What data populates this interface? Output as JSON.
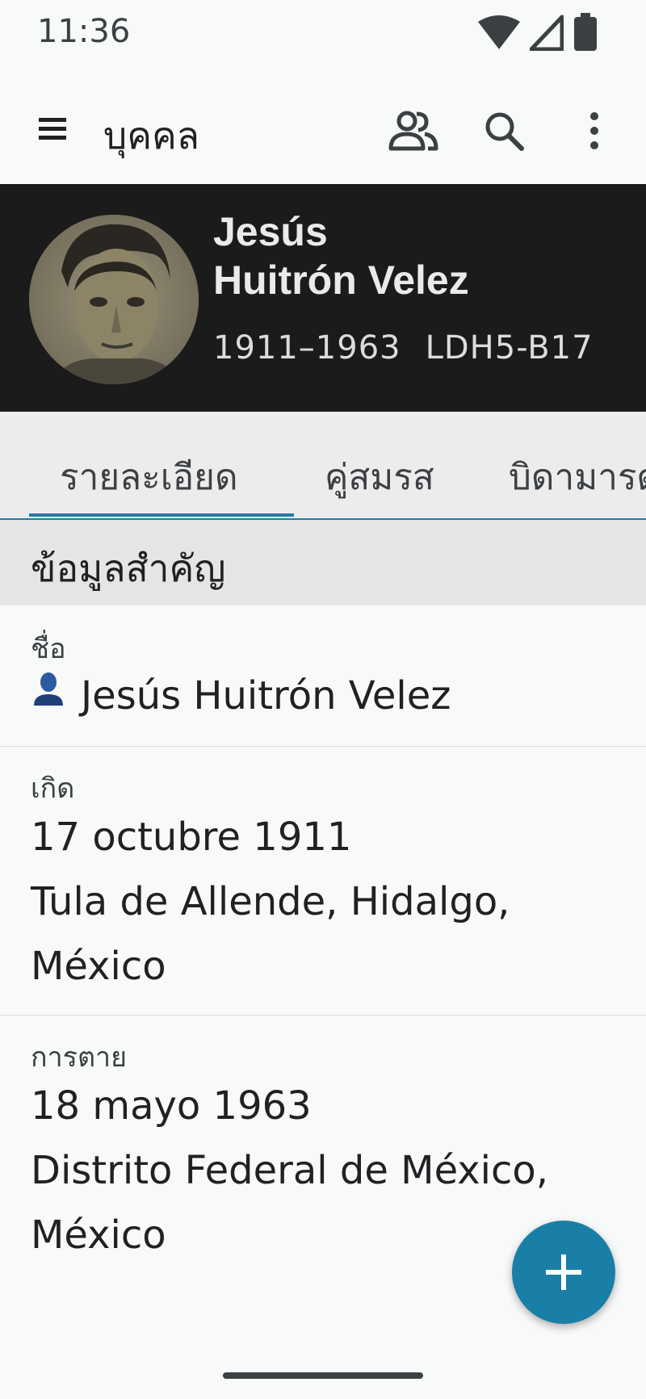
{
  "status_bar": {
    "time": "11:36"
  },
  "app_bar": {
    "title": "บุคคล"
  },
  "person": {
    "first_name": "Jesús",
    "surname": "Huitrón Velez",
    "lifespan": "1911–1963",
    "person_id": "LDH5-B17"
  },
  "tabs": [
    {
      "label": "รายละเอียด",
      "selected": true
    },
    {
      "label": "คู่สมรส",
      "selected": false
    },
    {
      "label": "บิดามารดา",
      "selected": false
    }
  ],
  "section": {
    "title": "ข้อมูลสำคัญ"
  },
  "vitals": {
    "name": {
      "label": "ชื่อ",
      "value": "Jesús Huitrón Velez"
    },
    "birth": {
      "label": "เกิด",
      "date": "17 octubre 1911",
      "place_line1": "Tula de Allende, Hidalgo,",
      "place_line2": "México"
    },
    "death": {
      "label": "การตาย",
      "date": "18 mayo 1963",
      "place_line1": "Distrito Federal de México,",
      "place_line2": "México"
    }
  },
  "colors": {
    "accent": "#1a7fa6",
    "header_bg": "#1b1b1c"
  }
}
